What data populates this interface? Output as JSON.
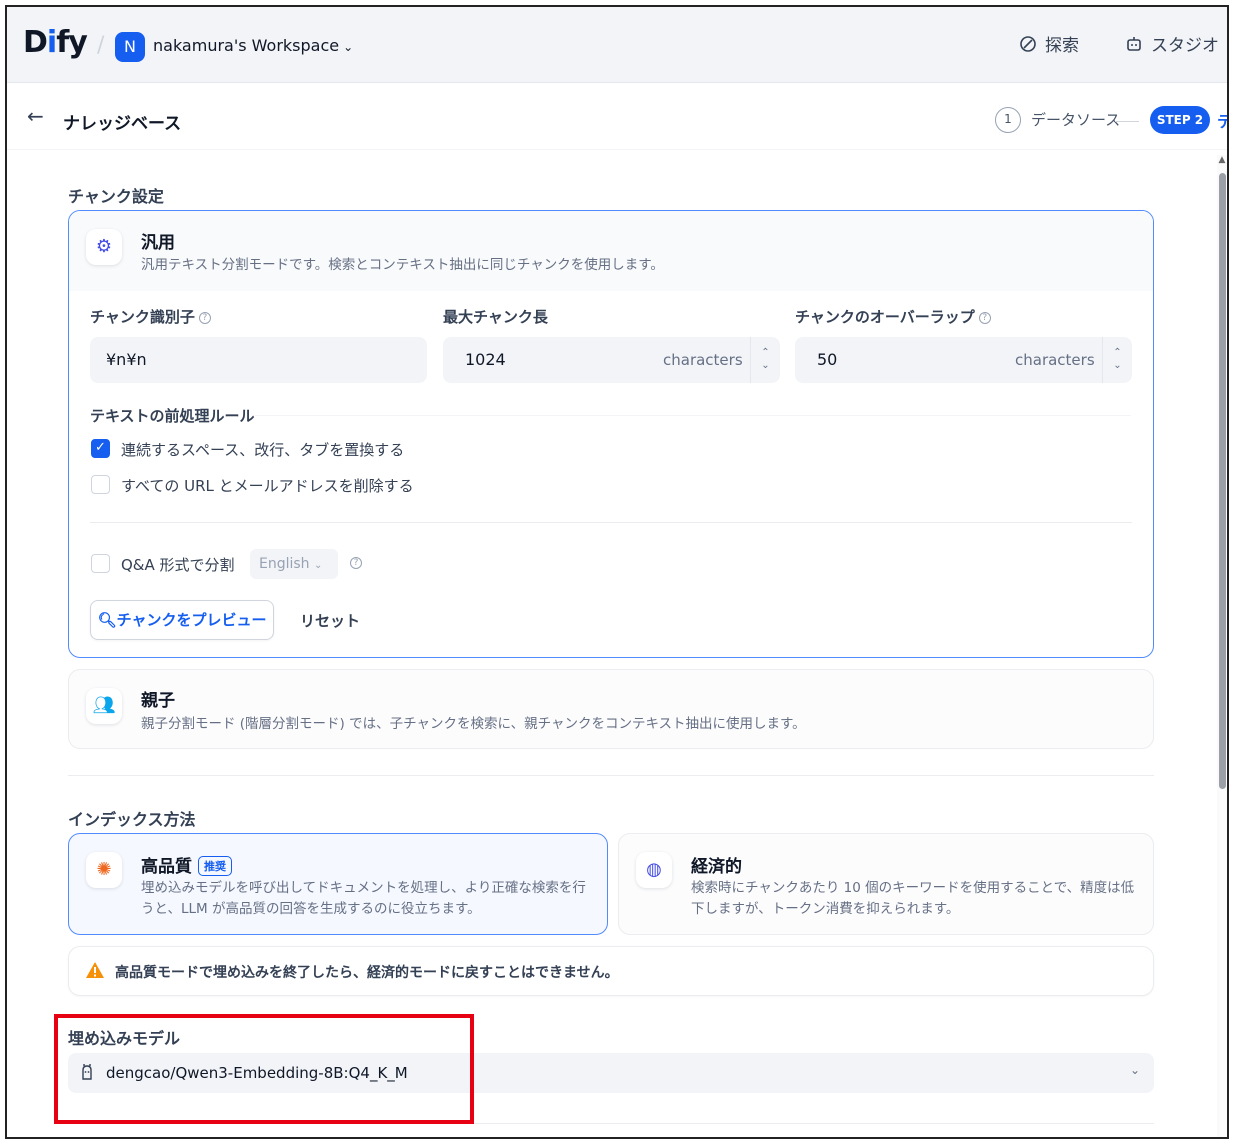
{
  "header": {
    "logo": "Dify",
    "workspace_initial": "N",
    "workspace_name": "nakamura's Workspace",
    "nav": [
      {
        "label": "探索",
        "icon": "compass-icon"
      },
      {
        "label": "スタジオ",
        "icon": "robot-icon"
      }
    ]
  },
  "subheader": {
    "breadcrumb": "ナレッジベース",
    "steps": [
      {
        "number": "1",
        "label": "データソース"
      },
      {
        "label": "STEP 2"
      },
      {
        "label": "テ"
      }
    ]
  },
  "chunk_settings": {
    "title": "チャンク設定",
    "general": {
      "title": "汎用",
      "description": "汎用テキスト分割モードです。検索とコンテキスト抽出に同じチャンクを使用します。",
      "identifier": {
        "label": "チャンク識別子",
        "value": "¥n¥n"
      },
      "max_length": {
        "label": "最大チャンク長",
        "value": "1024",
        "unit": "characters"
      },
      "overlap": {
        "label": "チャンクのオーバーラップ",
        "value": "50",
        "unit": "characters"
      },
      "rules_title": "テキストの前処理ルール",
      "rules": [
        {
          "label": "連続するスペース、改行、タブを置換する",
          "checked": true
        },
        {
          "label": "すべての URL とメールアドレスを削除する",
          "checked": false
        }
      ],
      "qa": {
        "label": "Q&A 形式で分割",
        "checked": false,
        "language": "English"
      },
      "preview_button": "チャンクをプレビュー",
      "reset_button": "リセット"
    },
    "parent_child": {
      "title": "親子",
      "description": "親子分割モード (階層分割モード) では、子チャンクを検索に、親チャンクをコンテキスト抽出に使用します。"
    }
  },
  "index_method": {
    "title": "インデックス方法",
    "high_quality": {
      "title": "高品質",
      "badge": "推奨",
      "description": "埋め込みモデルを呼び出してドキュメントを処理し、より正確な検索を行うと、LLM が高品質の回答を生成するのに役立ちます。"
    },
    "economical": {
      "title": "経済的",
      "description": "検索時にチャンクあたり 10 個のキーワードを使用することで、精度は低下しますが、トークン消費を抑えられます。"
    },
    "warning": "高品質モードで埋め込みを終了したら、経済的モードに戻すことはできません。"
  },
  "embedding": {
    "title": "埋め込みモデル",
    "model": "dengcao/Qwen3-Embedding-8B:Q4_K_M"
  },
  "colors": {
    "accent": "#155eef",
    "highlight_box": "#e60012",
    "warning": "#f79009"
  }
}
